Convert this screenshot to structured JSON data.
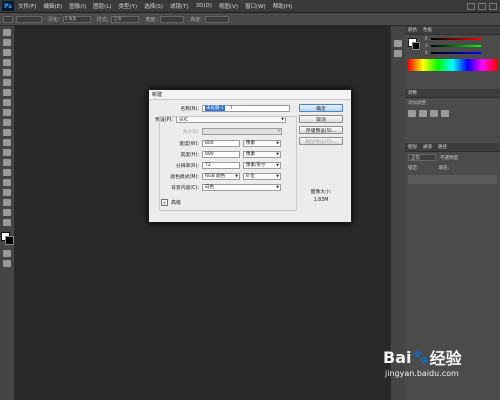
{
  "app": {
    "logo_text": "Ps"
  },
  "menu": [
    "文件(F)",
    "编辑(E)",
    "图像(I)",
    "图层(L)",
    "类型(Y)",
    "选择(S)",
    "滤镜(T)",
    "3D(D)",
    "视图(V)",
    "窗口(W)",
    "帮助(H)"
  ],
  "options": {
    "feather_label": "羽化:",
    "feather_value": "0 像素",
    "style_label": "样式:",
    "style_value": "正常",
    "width_label": "宽度:",
    "height_label": "高度:"
  },
  "dialog": {
    "title": "新建",
    "name_label": "名称(N):",
    "name_value": "未标题-1",
    "preset_label": "预设(P):",
    "preset_value": "自定",
    "size_label": "大小(I):",
    "width_label": "宽度(W):",
    "width_value": "800",
    "width_unit": "像素",
    "height_label": "高度(H):",
    "height_value": "800",
    "height_unit": "像素",
    "res_label": "分辨率(R):",
    "res_value": "72",
    "res_unit": "像素/英寸",
    "color_label": "颜色模式(M):",
    "color_mode": "RGB 颜色",
    "color_bits": "8 位",
    "bg_label": "背景内容(C):",
    "bg_value": "白色",
    "advanced_label": "高级",
    "ok": "确定",
    "cancel": "取消",
    "save_preset": "存储预设(S)...",
    "delete_preset": "删除预设(D)...",
    "image_size_label": "图像大小:",
    "image_size_value": "1.83M"
  },
  "panels": {
    "color_tab": "颜色",
    "swatches_tab": "色板",
    "adjust_tab": "调整",
    "adjust_hint": "添加调整",
    "layers_tab": "图层",
    "channels_tab": "通道",
    "paths_tab": "路径",
    "blend_mode": "正常",
    "opacity_label": "不透明度:",
    "lock_label": "锁定:",
    "fill_label": "填充:"
  },
  "watermark": {
    "brand": "Bai",
    "brand2": "经验",
    "url": "jingyan.baidu.com"
  }
}
